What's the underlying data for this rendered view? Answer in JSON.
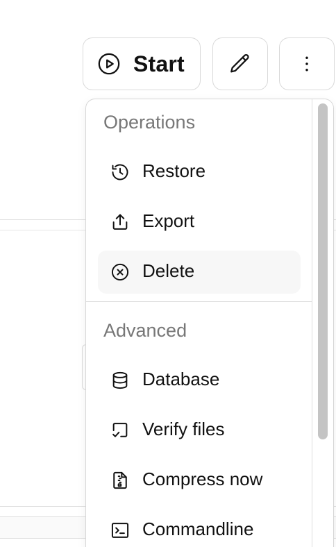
{
  "toolbar": {
    "start_label": "Start",
    "start_icon": "play-circle-icon",
    "edit_icon": "pencil-icon",
    "more_icon": "more-vertical-icon"
  },
  "menu": {
    "groups": [
      {
        "label": "Operations",
        "items": [
          {
            "label": "Restore",
            "icon": "history-icon"
          },
          {
            "label": "Export",
            "icon": "share-icon"
          },
          {
            "label": "Delete",
            "icon": "x-circle-icon",
            "active": true
          }
        ]
      },
      {
        "label": "Advanced",
        "items": [
          {
            "label": "Database",
            "icon": "database-icon"
          },
          {
            "label": "Verify files",
            "icon": "verify-icon"
          },
          {
            "label": "Compress now",
            "icon": "file-archive-icon"
          },
          {
            "label": "Commandline",
            "icon": "terminal-icon"
          }
        ]
      }
    ]
  },
  "colors": {
    "border": "#d9d9d9",
    "group_label": "#777777",
    "active_item_bg": "#f7f7f7",
    "scroll_thumb": "#c4c4c4",
    "text": "#111111"
  }
}
